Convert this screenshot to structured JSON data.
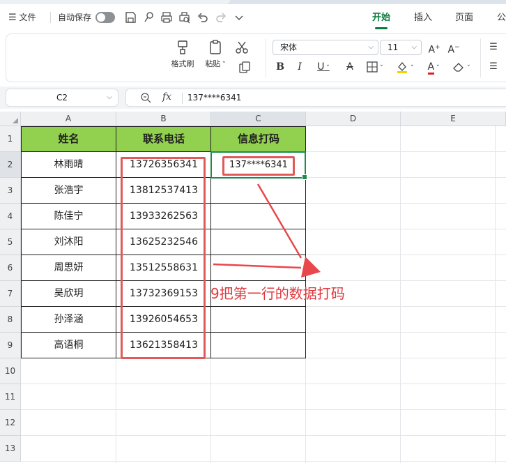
{
  "menu": {
    "file_label": "文件",
    "autosave_label": "自动保存",
    "ribbon_tabs": [
      "开始",
      "插入",
      "页面",
      "公"
    ],
    "active_tab": "开始"
  },
  "ribbon": {
    "format_painter_label": "格式刷",
    "paste_label": "粘贴",
    "font_name": "宋体",
    "font_size": "11"
  },
  "formula_bar": {
    "name_box": "C2",
    "fx_label": "fx",
    "value": "137****6341"
  },
  "sheet": {
    "columns": [
      "A",
      "B",
      "C",
      "D",
      "E"
    ],
    "rows": [
      "1",
      "2",
      "3",
      "4",
      "5",
      "6",
      "7",
      "8",
      "9",
      "10",
      "11",
      "12",
      "13"
    ],
    "headers": [
      "姓名",
      "联系电话",
      "信息打码"
    ],
    "records": [
      {
        "name": "林雨晴",
        "phone": "13726356341",
        "masked": "137****6341"
      },
      {
        "name": "张浩宇",
        "phone": "13812537413",
        "masked": ""
      },
      {
        "name": "陈佳宁",
        "phone": "13933262563",
        "masked": ""
      },
      {
        "name": "刘沐阳",
        "phone": "13625232546",
        "masked": ""
      },
      {
        "name": "周思妍",
        "phone": "13512558631",
        "masked": ""
      },
      {
        "name": "吴欣玥",
        "phone": "13732369153",
        "masked": ""
      },
      {
        "name": "孙泽涵",
        "phone": "13926054653",
        "masked": ""
      },
      {
        "name": "高语桐",
        "phone": "13621358413",
        "masked": ""
      }
    ],
    "header_fill": "#92d050",
    "active_cell_color": "#1f8a4c"
  },
  "annotation": {
    "text": "9把第一行的数据打码",
    "color": "#e0393e"
  }
}
